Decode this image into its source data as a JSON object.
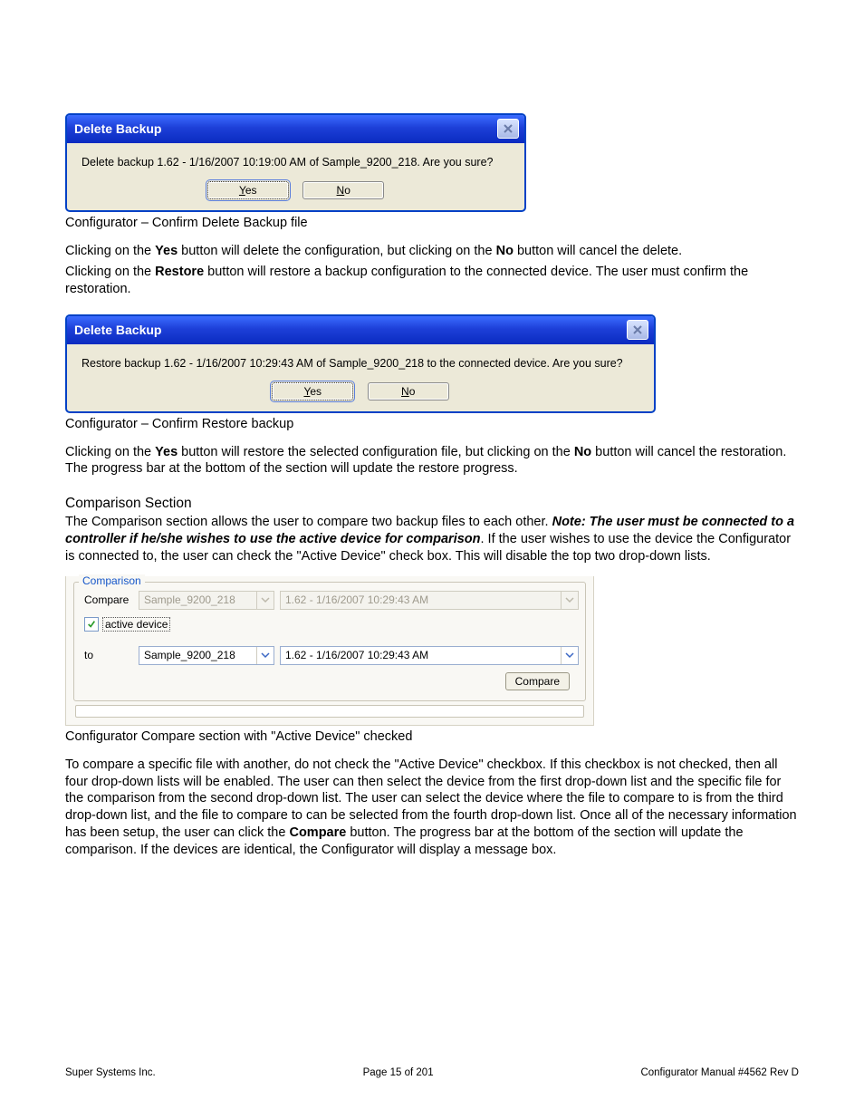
{
  "dialog1": {
    "title": "Delete Backup",
    "message": "Delete backup 1.62 - 1/16/2007 10:19:00 AM of Sample_9200_218.  Are you sure?",
    "yes": "Yes",
    "no": "No"
  },
  "caption1": "Configurator – Confirm Delete Backup file",
  "para1a_pre": "Clicking on the ",
  "para1a_b1": "Yes",
  "para1a_mid": " button will delete the configuration, but clicking on the ",
  "para1a_b2": "No",
  "para1a_post": " button will cancel the delete.",
  "para1b_pre": "Clicking on the ",
  "para1b_b1": "Restore",
  "para1b_post": " button will restore a backup configuration to the connected device.  The user must confirm the restoration.",
  "dialog2": {
    "title": "Delete Backup",
    "message": "Restore backup 1.62 - 1/16/2007 10:29:43 AM of Sample_9200_218 to the connected device.  Are you sure?",
    "yes": "Yes",
    "no": "No"
  },
  "caption2": "Configurator – Confirm Restore backup",
  "para2_pre": "Clicking on the ",
  "para2_b1": "Yes",
  "para2_mid": " button will restore the selected configuration file, but clicking on the ",
  "para2_b2": "No",
  "para2_post": " button will cancel the restoration.  The progress bar at the bottom of the section will update the restore progress.",
  "section_heading": "Comparison Section",
  "para3_pre": "The Comparison section allows the user to compare two backup files to each other.  ",
  "para3_note": "Note: The user must be connected to a controller if he/she wishes to use the active device for comparison",
  "para3_post": ".  If the user wishes to use the device the Configurator is connected to, the user can check the \"Active Device\" check box.  This will disable the top two drop-down lists.",
  "panel": {
    "legend": "Comparison",
    "compare_label": "Compare",
    "to_label": "to",
    "active_device": "active device",
    "device1": "Sample_9200_218",
    "file1": "1.62 - 1/16/2007 10:29:43 AM",
    "device2": "Sample_9200_218",
    "file2": "1.62 - 1/16/2007 10:29:43 AM",
    "compare_btn": "Compare"
  },
  "caption3": "Configurator Compare section with \"Active Device\" checked",
  "para4_pre": "To compare a specific file with another, do not check the \"Active Device\" checkbox.  If this checkbox is not checked, then all four drop-down lists will be enabled.  The user can then select the device from the first drop-down list and the specific file for the comparison from the second drop-down list.  The user can select the device where the file to compare to is from the third drop-down list, and the file to compare to can be selected from the fourth drop-down list.  Once all of the necessary information has been setup, the user can click the ",
  "para4_b1": "Compare",
  "para4_post": " button.  The progress bar at the bottom of the section will update the comparison.  If the devices are identical, the Configurator will display a message box.",
  "footer": {
    "left": "Super Systems Inc.",
    "center": "Page 15 of 201",
    "right": "Configurator Manual #4562 Rev D"
  }
}
